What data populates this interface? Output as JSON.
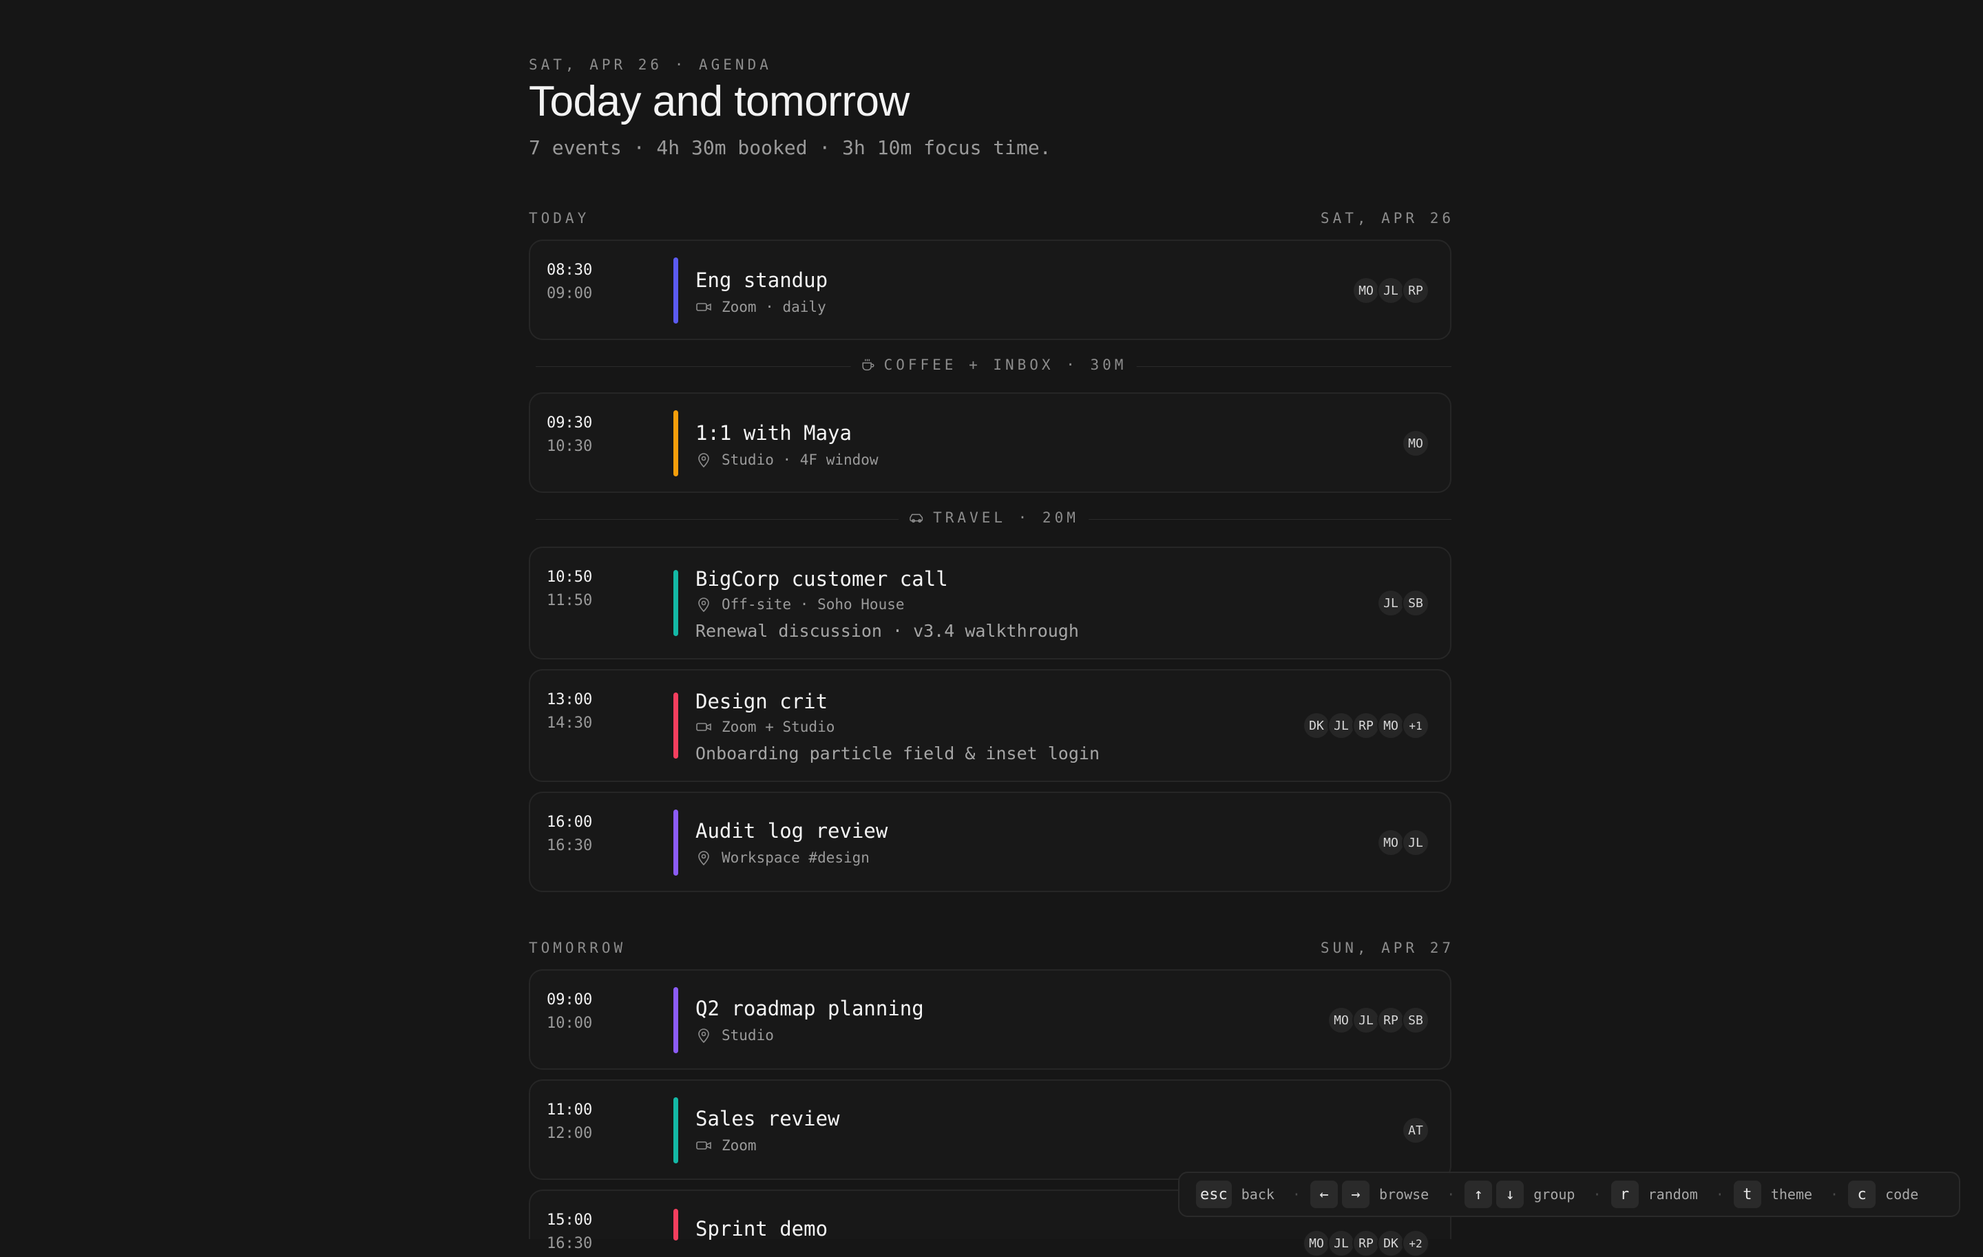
{
  "header": {
    "eyebrow": "SAT, APR 26 · AGENDA",
    "title": "Today and tomorrow",
    "subtitle": "7 events · 4h 30m booked · 3h 10m focus time."
  },
  "sections": [
    {
      "label": "TODAY",
      "date": "SAT, APR 26"
    },
    {
      "label": "TOMORROW",
      "date": "SUN, APR 27"
    }
  ],
  "gaps": [
    {
      "icon": "coffee-icon",
      "label": "COFFEE + INBOX · 30M"
    },
    {
      "icon": "car-icon",
      "label": "TRAVEL · 20M"
    }
  ],
  "events": [
    {
      "start": "08:30",
      "end": "09:00",
      "title": "Eng standup",
      "meta_icon": "video-icon",
      "meta": "Zoom · daily",
      "note": "",
      "color": "#5b5bf0",
      "attendees": [
        "MO",
        "JL",
        "RP"
      ]
    },
    {
      "start": "09:30",
      "end": "10:30",
      "title": "1:1 with Maya",
      "meta_icon": "location-pin-icon",
      "meta": "Studio · 4F window",
      "note": "",
      "color": "#f59e0b",
      "attendees": [
        "MO"
      ]
    },
    {
      "start": "10:50",
      "end": "11:50",
      "title": "BigCorp customer call",
      "meta_icon": "location-pin-icon",
      "meta": "Off-site · Soho House",
      "note": "Renewal discussion · v3.4 walkthrough",
      "color": "#14b8a6",
      "attendees": [
        "JL",
        "SB"
      ]
    },
    {
      "start": "13:00",
      "end": "14:30",
      "title": "Design crit",
      "meta_icon": "video-icon",
      "meta": "Zoom + Studio",
      "note": "Onboarding particle field & inset login",
      "color": "#f43f5e",
      "attendees": [
        "DK",
        "JL",
        "RP",
        "MO",
        "+1"
      ]
    },
    {
      "start": "16:00",
      "end": "16:30",
      "title": "Audit log review",
      "meta_icon": "location-pin-icon",
      "meta": "Workspace #design",
      "note": "",
      "color": "#8b5cf6",
      "attendees": [
        "MO",
        "JL"
      ]
    },
    {
      "start": "09:00",
      "end": "10:00",
      "title": "Q2 roadmap planning",
      "meta_icon": "location-pin-icon",
      "meta": "Studio",
      "note": "",
      "color": "#8b5cf6",
      "attendees": [
        "MO",
        "JL",
        "RP",
        "SB"
      ]
    },
    {
      "start": "11:00",
      "end": "12:00",
      "title": "Sales review",
      "meta_icon": "video-icon",
      "meta": "Zoom",
      "note": "",
      "color": "#14b8a6",
      "attendees": [
        "AT"
      ]
    },
    {
      "start": "15:00",
      "end": "16:30",
      "title": "Sprint demo",
      "meta_icon": "",
      "meta": "",
      "note": "",
      "color": "#f43f5e",
      "attendees": [
        "MO",
        "JL",
        "RP",
        "DK",
        "+2"
      ]
    }
  ],
  "shortcuts": [
    {
      "keys": [
        "esc"
      ],
      "label": "back"
    },
    {
      "keys": [
        "←",
        "→"
      ],
      "label": "browse"
    },
    {
      "keys": [
        "↑",
        "↓"
      ],
      "label": "group"
    },
    {
      "keys": [
        "r"
      ],
      "label": "random"
    },
    {
      "keys": [
        "t"
      ],
      "label": "theme"
    },
    {
      "keys": [
        "c"
      ],
      "label": "code"
    }
  ]
}
